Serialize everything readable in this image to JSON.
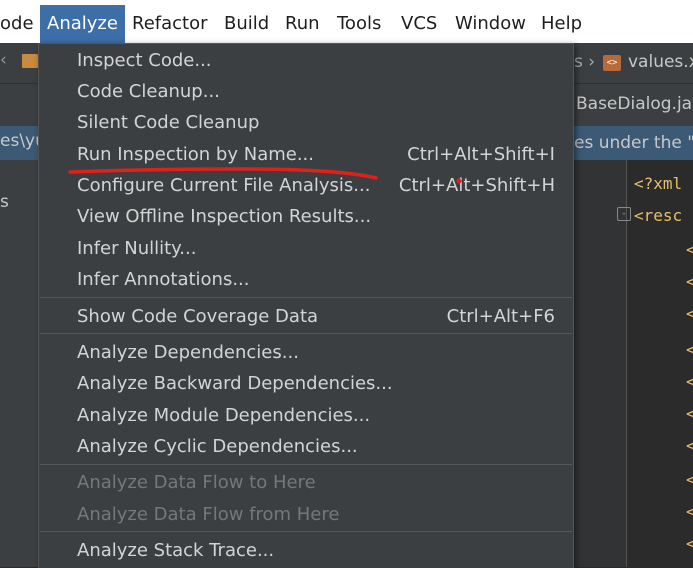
{
  "menubar": {
    "items": [
      {
        "label": "ode"
      },
      {
        "label": "Analyze"
      },
      {
        "label": "Refactor"
      },
      {
        "label": "Build"
      },
      {
        "label": "Run"
      },
      {
        "label": "Tools"
      },
      {
        "label": "VCS"
      },
      {
        "label": "Window"
      },
      {
        "label": "Help"
      }
    ]
  },
  "background": {
    "breadcrumb_right": "values.x",
    "tab_right": "BaseDialog.jav",
    "path_left": "es\\yu",
    "notice_right": "es under the \"",
    "left_letter": "s",
    "code_line1": "<?xml",
    "code_line2": "<resc",
    "code_char": "<"
  },
  "dropdown": {
    "items": [
      {
        "label": "Inspect Code...",
        "shortcut": "",
        "disabled": false
      },
      {
        "label": "Code Cleanup...",
        "shortcut": "",
        "disabled": false
      },
      {
        "label": "Silent Code Cleanup",
        "shortcut": "",
        "disabled": false
      },
      {
        "label": "Run Inspection by Name...",
        "shortcut": "Ctrl+Alt+Shift+I",
        "disabled": false
      },
      {
        "label": "Configure Current File Analysis...",
        "shortcut": "Ctrl+Alt+Shift+H",
        "disabled": false
      },
      {
        "label": "View Offline Inspection Results...",
        "shortcut": "",
        "disabled": false
      },
      {
        "label": "Infer Nullity...",
        "shortcut": "",
        "disabled": false
      },
      {
        "label": "Infer Annotations...",
        "shortcut": "",
        "disabled": false
      },
      {
        "label": "Show Code Coverage Data",
        "shortcut": "Ctrl+Alt+F6",
        "disabled": false
      },
      {
        "label": "Analyze Dependencies...",
        "shortcut": "",
        "disabled": false
      },
      {
        "label": "Analyze Backward Dependencies...",
        "shortcut": "",
        "disabled": false
      },
      {
        "label": "Analyze Module Dependencies...",
        "shortcut": "",
        "disabled": false
      },
      {
        "label": "Analyze Cyclic Dependencies...",
        "shortcut": "",
        "disabled": false
      },
      {
        "label": "Analyze Data Flow to Here",
        "shortcut": "",
        "disabled": true
      },
      {
        "label": "Analyze Data Flow from Here",
        "shortcut": "",
        "disabled": true
      },
      {
        "label": "Analyze Stack Trace...",
        "shortcut": "",
        "disabled": false
      }
    ]
  },
  "colors": {
    "menu_highlight": "#3d6ea8",
    "dropdown_bg": "#3c3f41",
    "annotation_red": "#e0201a"
  }
}
